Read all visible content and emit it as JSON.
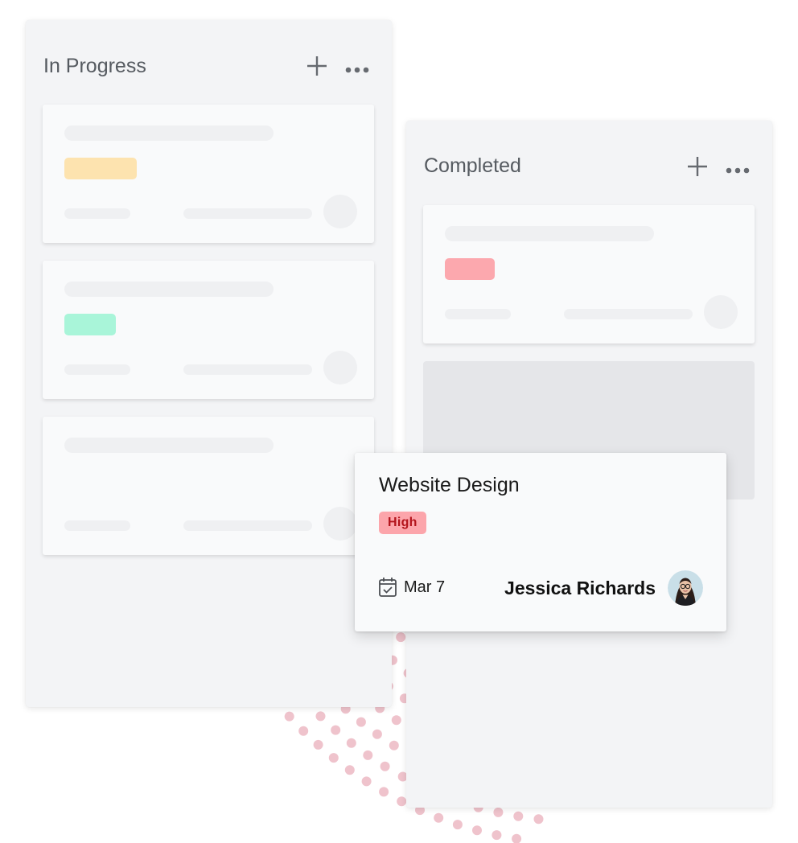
{
  "colors": {
    "badge_yellow": "#fde3af",
    "badge_green": "#a9f5d9",
    "badge_red": "#fca8ae",
    "high_priority_bg": "#fca5ab",
    "high_priority_text": "#b3141c",
    "dot_pattern": "#e8a9b6"
  },
  "board": {
    "columns": [
      {
        "title": "In Progress",
        "actions": {
          "add_icon": "plus-icon",
          "more_icon": "more-horizontal-icon"
        },
        "cards": [
          {
            "state": "placeholder",
            "tag_color": "badge_yellow"
          },
          {
            "state": "placeholder",
            "tag_color": "badge_green"
          },
          {
            "state": "placeholder",
            "tag_color": null
          }
        ]
      },
      {
        "title": "Completed",
        "actions": {
          "add_icon": "plus-icon",
          "more_icon": "more-horizontal-icon"
        },
        "cards": [
          {
            "state": "placeholder",
            "tag_color": "badge_red"
          }
        ],
        "drop_zone": true
      }
    ]
  },
  "dragged_card": {
    "title": "Website Design",
    "priority": "High",
    "due_date": "Mar 7",
    "due_icon": "calendar-check-icon",
    "assignee": "Jessica Richards",
    "avatar_icon": "avatar-photo"
  }
}
